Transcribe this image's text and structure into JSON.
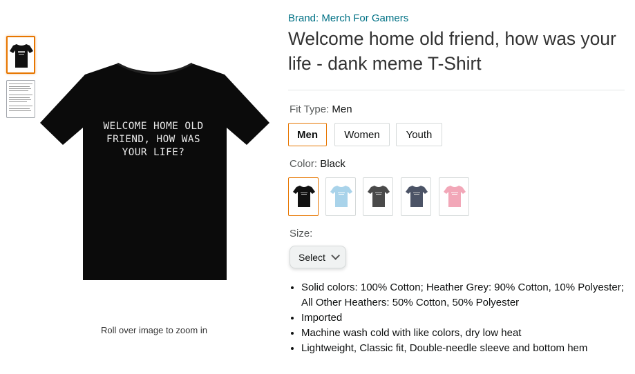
{
  "gallery": {
    "zoom_hint": "Roll over image to zoom in",
    "shirt_text": "WELCOME HOME OLD\nFRIEND, HOW WAS\nYOUR LIFE?"
  },
  "product": {
    "brand": "Brand: Merch For Gamers",
    "title": "Welcome home old friend, how was your life - dank meme T-Shirt"
  },
  "fit_type": {
    "label": "Fit Type:",
    "selected": "Men",
    "options": [
      "Men",
      "Women",
      "Youth"
    ]
  },
  "color": {
    "label": "Color:",
    "selected": "Black",
    "swatches": [
      {
        "name": "Black",
        "hex": "#111111"
      },
      {
        "name": "Light Blue",
        "hex": "#a9d3ea"
      },
      {
        "name": "Dark Heather",
        "hex": "#4a4a4a"
      },
      {
        "name": "Navy Heather",
        "hex": "#4b5366"
      },
      {
        "name": "Pink",
        "hex": "#f2a7b8"
      }
    ]
  },
  "size": {
    "label": "Size:",
    "select_label": "Select"
  },
  "features": [
    "Solid colors: 100% Cotton; Heather Grey: 90% Cotton, 10% Polyester; All Other Heathers: 50% Cotton, 50% Polyester",
    "Imported",
    "Machine wash cold with like colors, dry low heat",
    "Lightweight, Classic fit, Double-needle sleeve and bottom hem"
  ],
  "colors": {
    "link": "#007185",
    "selected_border": "#e77600"
  }
}
